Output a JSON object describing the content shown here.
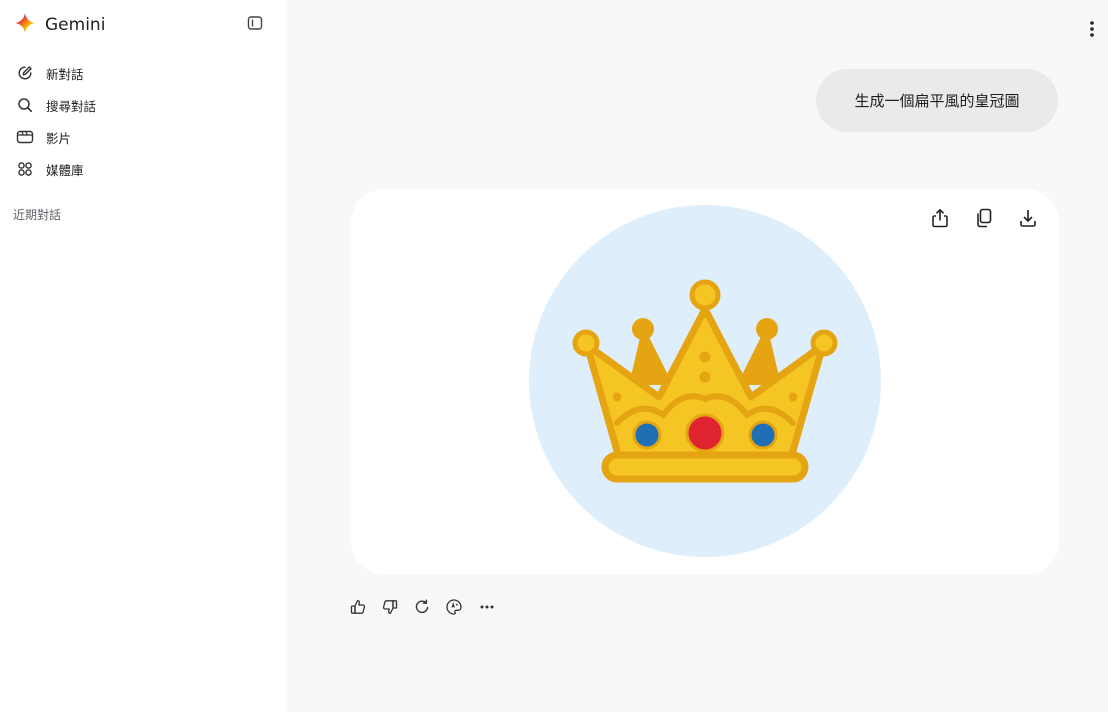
{
  "brand": {
    "name": "Gemini",
    "icon": "gemini-sparkle-icon",
    "colors": [
      "#4285f4",
      "#ea4335",
      "#fbbc04",
      "#34a853"
    ]
  },
  "sidebar": {
    "toggle_icon": "sidebar-toggle-icon",
    "items": [
      {
        "label": "新對話",
        "icon": "edit-icon"
      },
      {
        "label": "搜尋對話",
        "icon": "search-icon"
      },
      {
        "label": "影片",
        "icon": "video-icon"
      },
      {
        "label": "媒體庫",
        "icon": "grid-icon"
      }
    ],
    "recent_heading": "近期對話"
  },
  "header": {
    "more_icon": "more-vert-icon"
  },
  "conversation": {
    "user_message": "生成一個扁平風的皇冠圖",
    "image_card": {
      "description_icon": "crown-image",
      "actions": [
        {
          "name": "share",
          "icon": "share-icon"
        },
        {
          "name": "copy",
          "icon": "copy-icon"
        },
        {
          "name": "download",
          "icon": "download-icon"
        }
      ],
      "background_color": "#dfeefb",
      "crown_colors": {
        "gold": "#f5c623",
        "dark_gold": "#e5a411",
        "ruby": "#e02330",
        "sapphire": "#1f6fb5"
      }
    },
    "feedback": [
      {
        "name": "thumbs-up",
        "icon": "thumbs-up-icon"
      },
      {
        "name": "thumbs-down",
        "icon": "thumbs-down-icon"
      },
      {
        "name": "regenerate",
        "icon": "refresh-icon"
      },
      {
        "name": "edit-image",
        "icon": "palette-icon"
      },
      {
        "name": "more",
        "icon": "more-horiz-icon"
      }
    ]
  }
}
